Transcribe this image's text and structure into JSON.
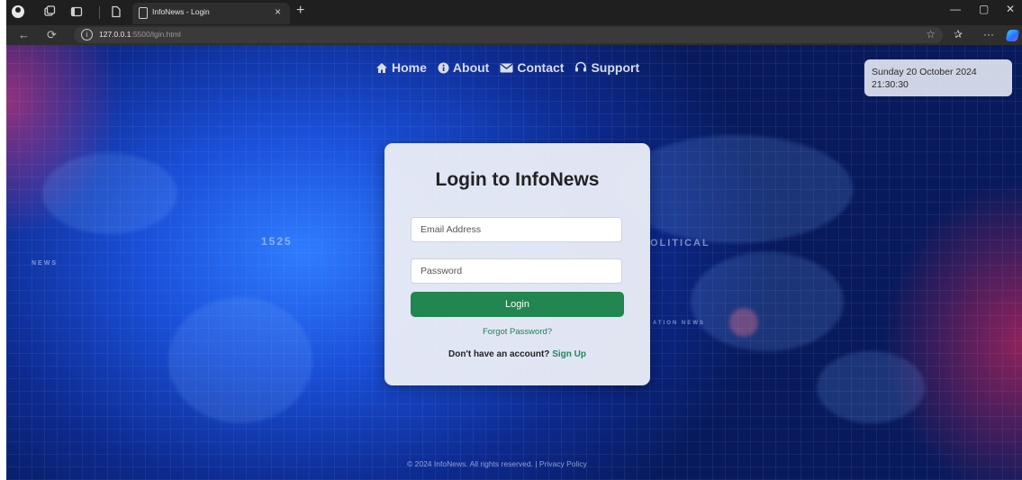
{
  "browser": {
    "tab_title": "InfoNews - Login",
    "tab_close": "×",
    "new_tab": "+",
    "url_host": "127.0.0.1",
    "url_rest": ":5500/lgin.html",
    "window_controls": [
      "—",
      "▢",
      "✕"
    ],
    "icons": [
      "profile-icon",
      "workspaces-icon",
      "tab-actions-icon",
      "page-icon",
      "back-icon",
      "refresh-icon",
      "info-icon",
      "favorite-star-icon",
      "favorites-icon",
      "more-icon",
      "copilot-icon"
    ]
  },
  "nav": {
    "home": "Home",
    "about": "About",
    "contact": "Contact",
    "support": "Support"
  },
  "clock": {
    "date": "Sunday 20 October 2024",
    "time": "21:30:30"
  },
  "background_text": {
    "number": "1525",
    "political": "OLITICAL",
    "news_left": "NEWS",
    "ation_news": "ATION NEWS"
  },
  "login": {
    "title": "Login to InfoNews",
    "email_placeholder": "Email Address",
    "password_placeholder": "Password",
    "button": "Login",
    "forgot": "Forgot Password?",
    "no_account": "Don't have an account?",
    "signup": "Sign Up"
  },
  "footer": {
    "text": "© 2024 InfoNews. All rights reserved. | Privacy Policy"
  },
  "colors": {
    "accent_green": "#21864f",
    "link_green": "#1f7f57"
  }
}
